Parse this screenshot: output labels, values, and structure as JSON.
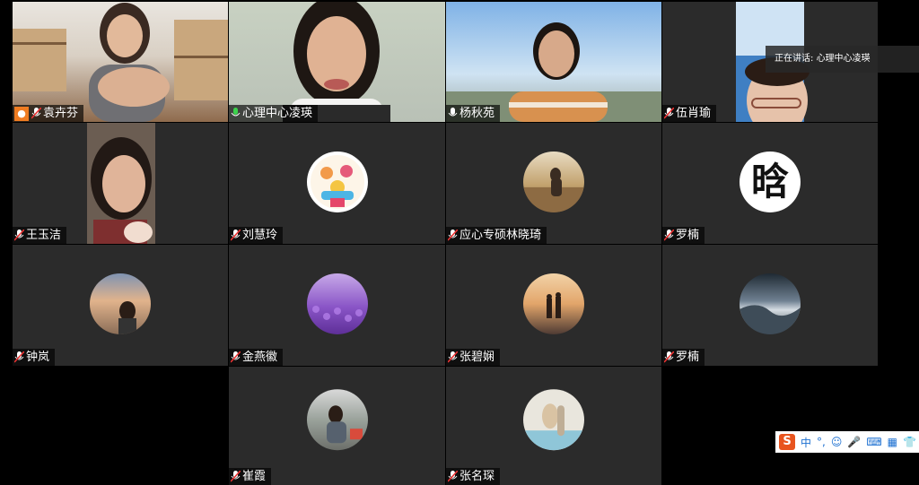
{
  "speaking_indicator": {
    "label": "正在讲话:",
    "speaker": "心理中心凌瑛"
  },
  "participants": [
    {
      "name": "袁卉芬"
    },
    {
      "name": "心理中心凌瑛"
    },
    {
      "name": "杨秋苑"
    },
    {
      "name": "伍肖瑜"
    },
    {
      "name": "王玉洁"
    },
    {
      "name": "刘慧玲"
    },
    {
      "name": "应心专硕林晓琦"
    },
    {
      "name": "罗楠"
    },
    {
      "name": "钟岚"
    },
    {
      "name": "金燕徽"
    },
    {
      "name": "张碧娴"
    },
    {
      "name": "罗楠"
    },
    {
      "name": "崔霞"
    },
    {
      "name": "张名琛"
    }
  ],
  "avatar_glyph": "晗",
  "ime_toolbar": {
    "logo": "S",
    "mode": "中",
    "punct": "°,"
  },
  "colors": {
    "active_border": "#24b33a",
    "tile_bg": "#2b2b2b",
    "ime_logo": "#e8541e"
  }
}
